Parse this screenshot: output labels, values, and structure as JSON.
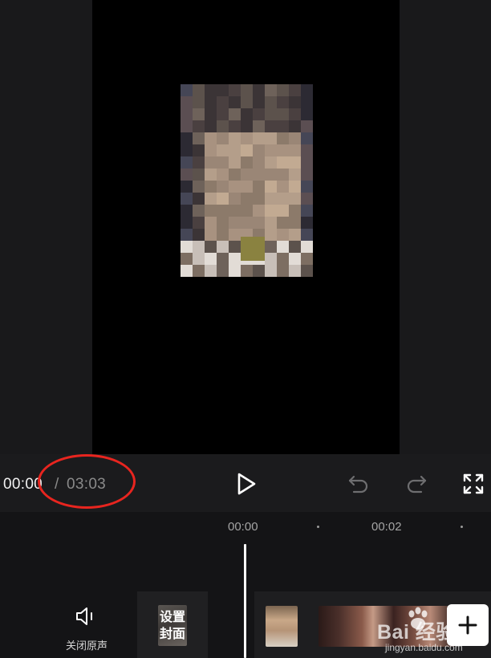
{
  "player": {
    "current_time": "00:00",
    "separator": "/",
    "total_time": "03:03"
  },
  "timeline": {
    "ruler_labels": [
      "00:00",
      "00:02"
    ]
  },
  "track_controls": {
    "mute_label": "关闭原声",
    "cover_label": "设置封面"
  },
  "watermark": {
    "text": "Bai 经验",
    "sub": "jingyan.baidu.com"
  },
  "icons": {
    "play": "play-icon",
    "undo": "undo-icon",
    "redo": "redo-icon",
    "fullscreen": "fullscreen-icon",
    "mute": "speaker-icon",
    "add": "plus-icon"
  },
  "colors": {
    "highlight": "#e8251f",
    "background": "#1b1b1d",
    "timeline_bg": "#141416",
    "text_primary": "#f2f2f2",
    "text_secondary": "#8a8a8a"
  }
}
